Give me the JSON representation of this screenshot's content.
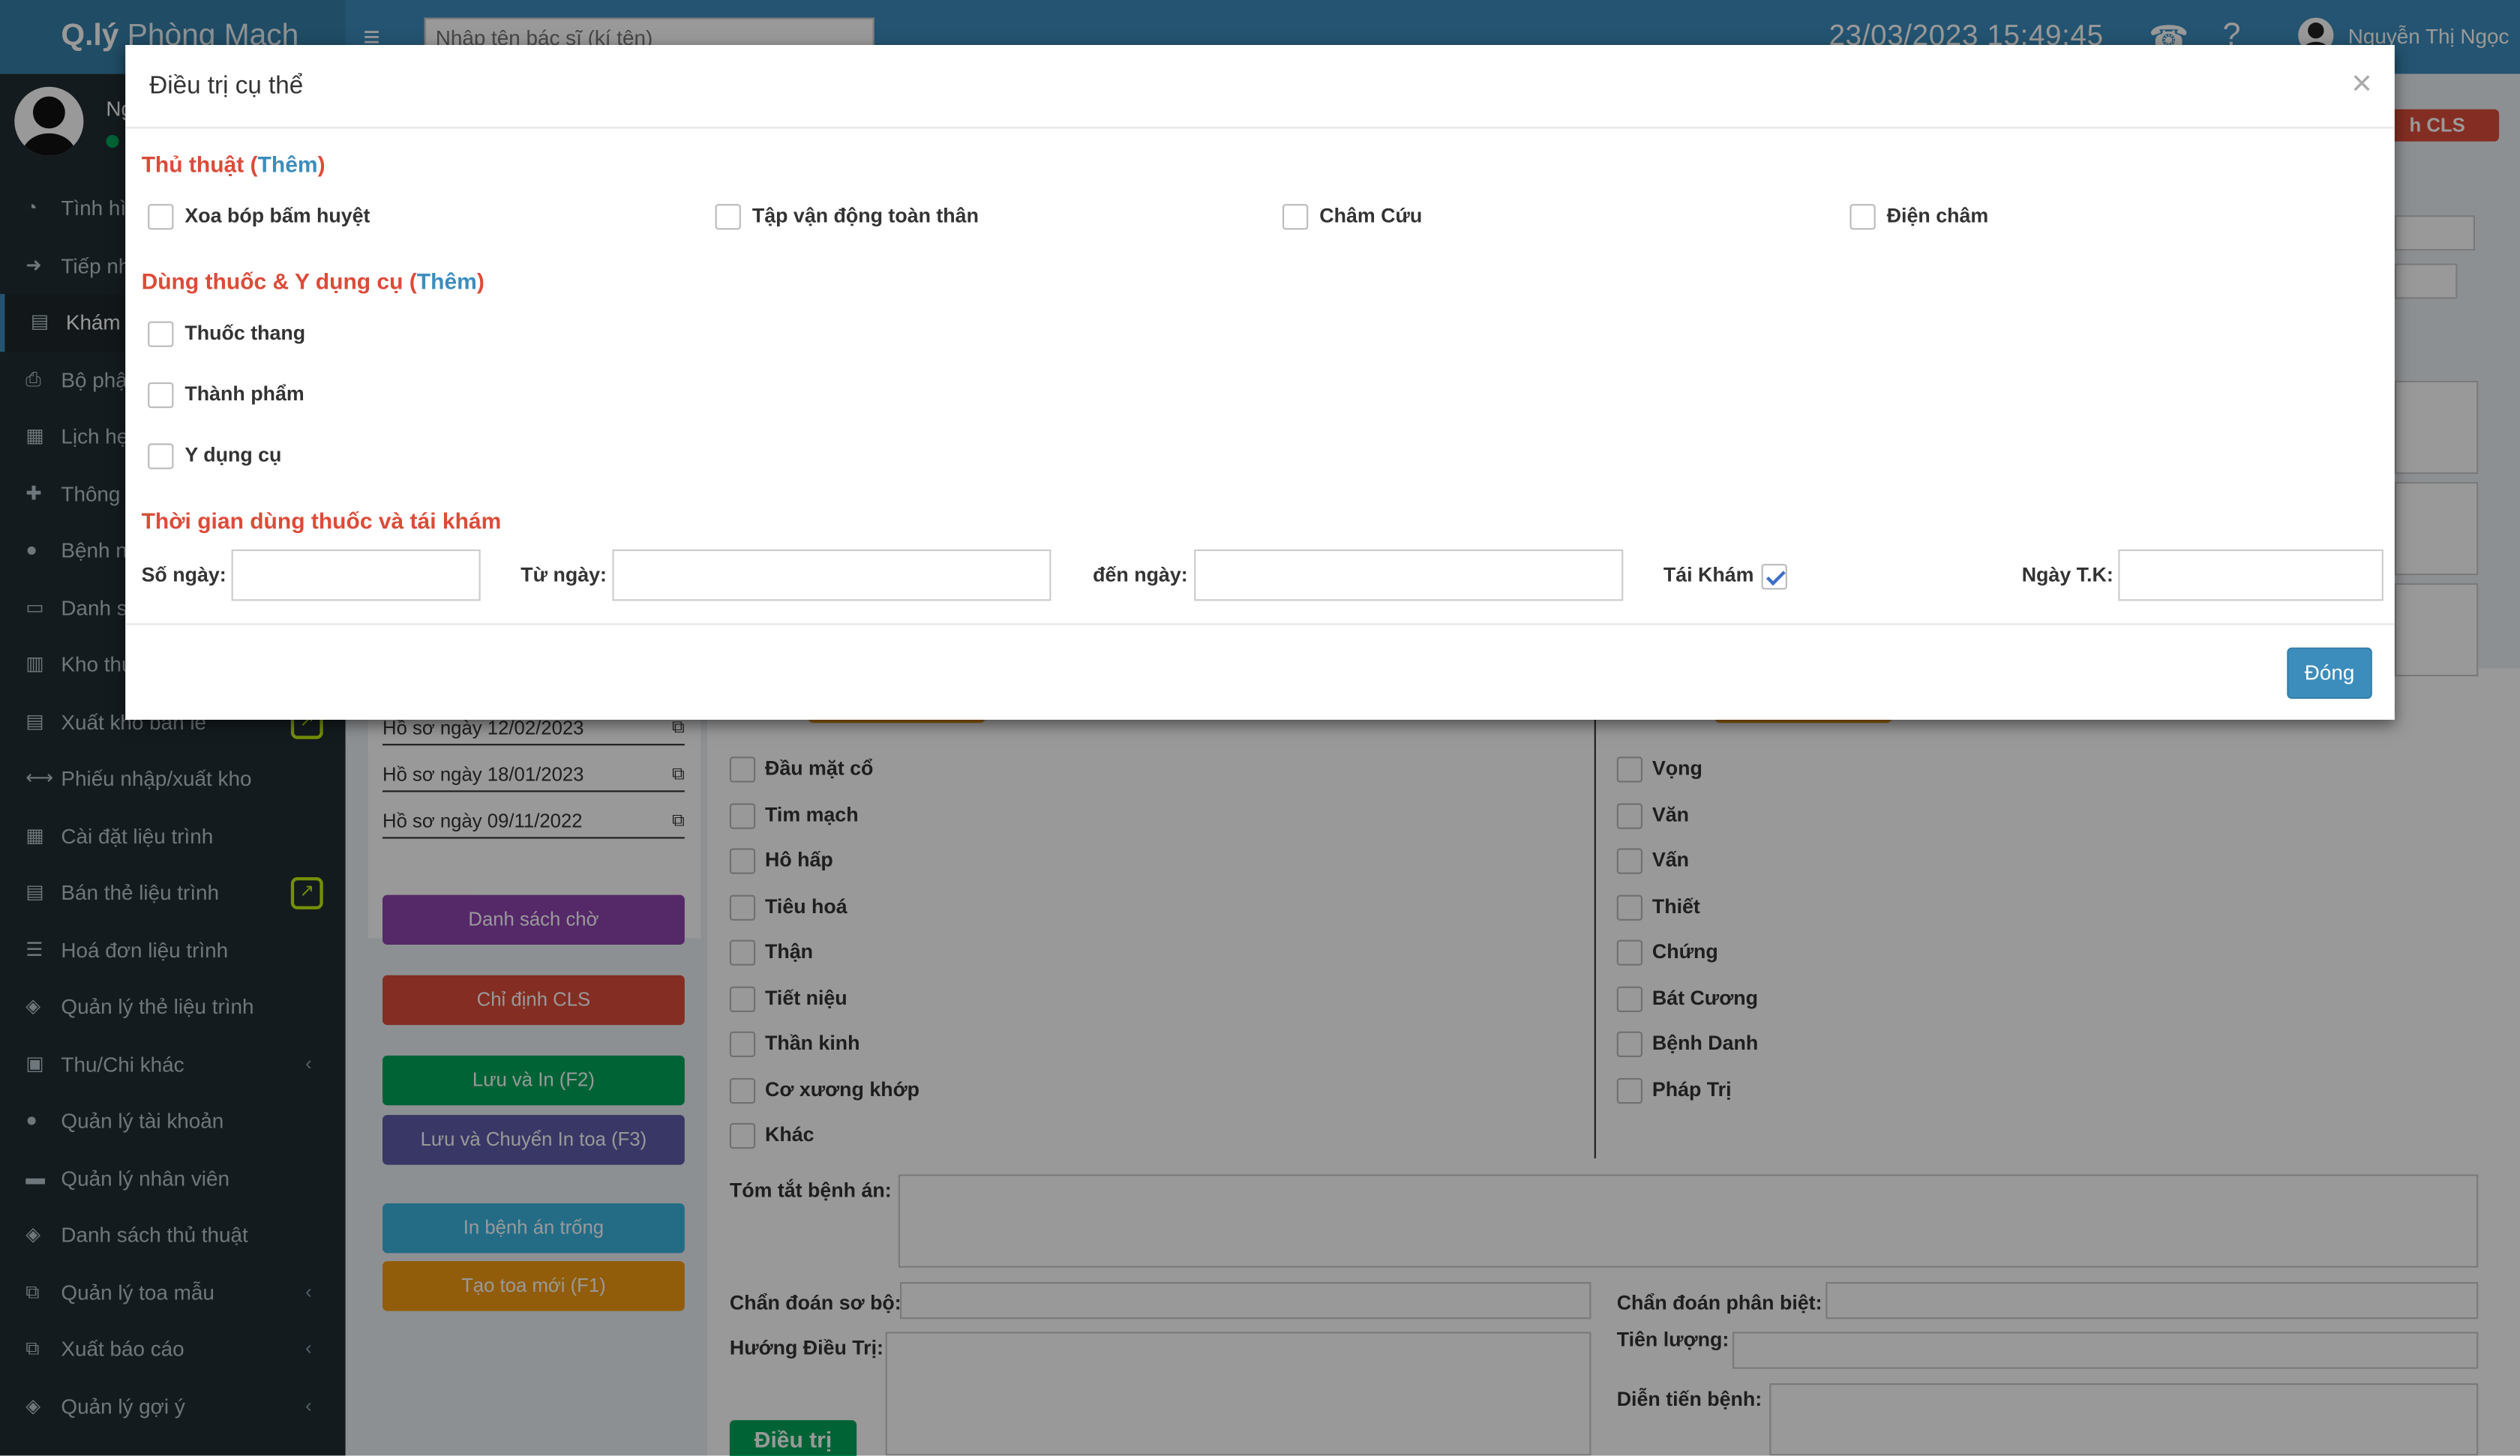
{
  "header": {
    "logo_bold": "Q.lý",
    "logo_rest": " Phòng Mạch",
    "search_placeholder": "Nhập tên bác sĩ (kí tên)",
    "datetime": "23/03/2023   15:49:45",
    "user_name": "Nguyễn Thị Ngọc"
  },
  "sidebar": {
    "user_short": "Ng",
    "items": [
      {
        "label": "Tình hì"
      },
      {
        "label": "Tiếp nh"
      },
      {
        "label": "Khám b"
      },
      {
        "label": "Bộ phậ"
      },
      {
        "label": "Lịch hẹ"
      },
      {
        "label": "Thông t"
      },
      {
        "label": "Bệnh nh"
      },
      {
        "label": "Danh sá"
      },
      {
        "label": "Kho thu"
      },
      {
        "label": "Xuất kho bán lẻ"
      },
      {
        "label": "Phiếu nhập/xuất kho"
      },
      {
        "label": "Cài đặt liệu trình"
      },
      {
        "label": "Bán thẻ liệu trình"
      },
      {
        "label": "Hoá đơn liệu trình"
      },
      {
        "label": "Quản lý thẻ liệu trình"
      },
      {
        "label": "Thu/Chi khác"
      },
      {
        "label": "Quản lý tài khoản"
      },
      {
        "label": "Quản lý nhân viên"
      },
      {
        "label": "Danh sách thủ thuật"
      },
      {
        "label": "Quản lý toa mẫu"
      },
      {
        "label": "Xuất báo cáo"
      },
      {
        "label": "Quản lý gợi ý"
      }
    ]
  },
  "background": {
    "cls_badge": "h CLS",
    "history": [
      "Hồ sơ ngày 12/02/2023",
      "Hồ sơ ngày 18/01/2023",
      "Hồ sơ ngày 09/11/2022"
    ],
    "buttons": {
      "waitlist": "Danh sách chờ",
      "cls": "Chỉ định CLS",
      "save_print": "Lưu và In (F2)",
      "save_transfer": "Lưu và Chuyển In toa (F3)",
      "print_blank": "In bệnh án trống",
      "new_rx": "Tạo toa mới (F1)"
    },
    "left_checks": [
      "Đầu mặt cổ",
      "Tim mạch",
      "Hô hấp",
      "Tiêu hoá",
      "Thận",
      "Tiết niệu",
      "Thần kinh",
      "Cơ xương khớp",
      "Khác"
    ],
    "right_checks": [
      "Vọng",
      "Văn",
      "Vấn",
      "Thiết",
      "Chứng",
      "Bát Cương",
      "Bệnh Danh",
      "Pháp Trị"
    ],
    "labels": {
      "summary": "Tóm tắt bệnh án:",
      "prelim_dx": "Chẩn đoán sơ bộ:",
      "diff_dx": "Chẩn đoán phân biệt:",
      "treatment_dir": "Hướng Điều Trị:",
      "prognosis": "Tiên lượng:",
      "progress": "Diễn tiến bệnh:",
      "treat_btn": "Điều trị"
    }
  },
  "modal": {
    "title": "Điều trị cụ thể",
    "procedures": {
      "title": "Thủ thuật",
      "add": "Thêm",
      "items": [
        "Xoa bóp bấm huyệt",
        "Tập vận động toàn thân",
        "Châm Cứu",
        "Điện châm"
      ]
    },
    "drugs": {
      "title": "Dùng thuốc & Y dụng cụ",
      "add": "Thêm",
      "items": [
        "Thuốc thang",
        "Thành phẩm",
        "Y dụng cụ"
      ]
    },
    "schedule": {
      "title": "Thời gian dùng thuốc và tái khám",
      "days_label": "Số ngày:",
      "days_value": "",
      "from_label": "Từ ngày:",
      "from_value": "",
      "to_label": "đến ngày:",
      "to_value": "",
      "revisit_label": "Tái Khám",
      "revisit_checked": true,
      "revisit_date_label": "Ngày T.K:",
      "revisit_date_value": ""
    },
    "close_button": "Đóng"
  }
}
